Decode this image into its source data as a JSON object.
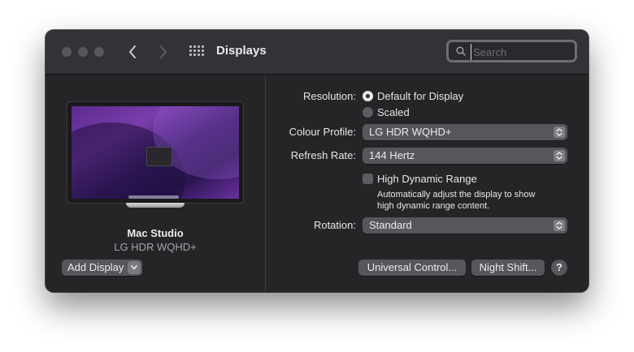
{
  "window": {
    "title": "Displays",
    "traffic_lights": [
      "close",
      "minimize",
      "zoom"
    ]
  },
  "toolbar": {
    "back_icon": "chevron-left-icon",
    "forward_icon": "chevron-right-icon",
    "grid_icon": "show-all-grid-icon"
  },
  "search": {
    "placeholder": "Search",
    "value": ""
  },
  "device": {
    "name": "Mac Studio",
    "model": "LG HDR WQHD+",
    "add_display_label": "Add Display"
  },
  "settings": {
    "resolution_label": "Resolution:",
    "resolution_options": [
      {
        "label": "Default for Display",
        "selected": true
      },
      {
        "label": "Scaled",
        "selected": false
      }
    ],
    "colour_profile_label": "Colour Profile:",
    "colour_profile_value": "LG HDR WQHD+",
    "refresh_rate_label": "Refresh Rate:",
    "refresh_rate_value": "144 Hertz",
    "hdr_label": "High Dynamic Range",
    "hdr_checked": false,
    "hdr_help_line1": "Automatically adjust the display to show",
    "hdr_help_line2": "high dynamic range content.",
    "rotation_label": "Rotation:",
    "rotation_value": "Standard"
  },
  "buttons": {
    "universal_control": "Universal Control...",
    "night_shift": "Night Shift...",
    "help": "?"
  },
  "colors": {
    "window_bg": "#262427",
    "titlebar_bg": "#343236",
    "control_bg": "#58565b",
    "text": "#e7e6e8",
    "secondary_text": "#a5a3a8"
  }
}
